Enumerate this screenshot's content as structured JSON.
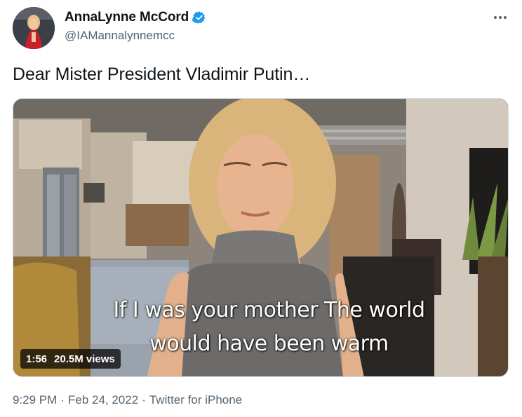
{
  "author": {
    "display_name": "AnnaLynne McCord",
    "handle": "@IAMannalynnemcc",
    "verified": true,
    "avatar_icon": "profile-photo"
  },
  "tweet": {
    "text": "Dear Mister President Vladimir Putin…"
  },
  "media": {
    "caption_line_1": "If I was your mother The world",
    "caption_line_2": "would have been warm",
    "duration": "1:56",
    "views": "20.5M views"
  },
  "meta": {
    "time": "9:29 PM",
    "date": "Feb 24, 2022",
    "source": "Twitter for iPhone",
    "separator": "·"
  },
  "icons": {
    "verified": "verified-badge-icon",
    "more": "more-options-icon"
  },
  "colors": {
    "verified_blue": "#1d9bf0",
    "secondary_text": "#536471",
    "primary_text": "#0f1419"
  }
}
